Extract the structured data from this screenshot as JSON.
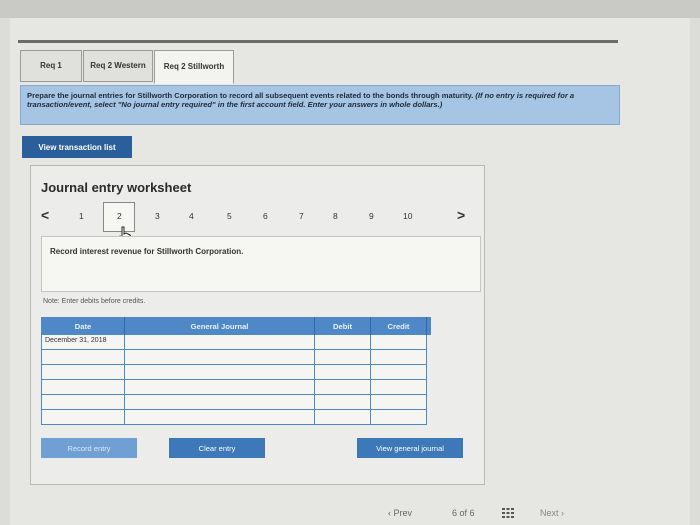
{
  "tabs": [
    {
      "label": "Req 1",
      "active": false
    },
    {
      "label": "Req 2 Western",
      "active": false
    },
    {
      "label": "Req 2 Stillworth",
      "active": true
    }
  ],
  "instructions": {
    "main": "Prepare the journal entries for Stillworth Corporation to record all subsequent events related to the bonds through maturity.",
    "italic": "(If no entry is required for a transaction/event, select \"No journal entry required\" in the first account field. Enter your answers in whole dollars.)"
  },
  "buttons": {
    "view_transaction_list": "View transaction list",
    "record_entry": "Record entry",
    "clear_entry": "Clear entry",
    "view_general_journal": "View general journal"
  },
  "worksheet": {
    "title": "Journal entry worksheet",
    "pages": [
      "1",
      "2",
      "3",
      "4",
      "5",
      "6",
      "7",
      "8",
      "9",
      "10"
    ],
    "active_page": "2",
    "prev_arrow": "<",
    "next_arrow": ">",
    "description": "Record interest revenue for Stillworth Corporation.",
    "note": "Note: Enter debits before credits."
  },
  "journal": {
    "headers": {
      "date": "Date",
      "account": "General Journal",
      "debit": "Debit",
      "credit": "Credit"
    },
    "rows": [
      {
        "date": "December 31, 2018",
        "account": "",
        "debit": "",
        "credit": ""
      },
      {
        "date": "",
        "account": "",
        "debit": "",
        "credit": ""
      },
      {
        "date": "",
        "account": "",
        "debit": "",
        "credit": ""
      },
      {
        "date": "",
        "account": "",
        "debit": "",
        "credit": ""
      },
      {
        "date": "",
        "account": "",
        "debit": "",
        "credit": ""
      },
      {
        "date": "",
        "account": "",
        "debit": "",
        "credit": ""
      }
    ]
  },
  "footer": {
    "prev": "Prev",
    "page_counter": "6 of 6",
    "next": "Next"
  },
  "colors": {
    "accent": "#3d78b8",
    "instruction_bg": "#a6c4e4",
    "table_header": "#4e88c6"
  }
}
